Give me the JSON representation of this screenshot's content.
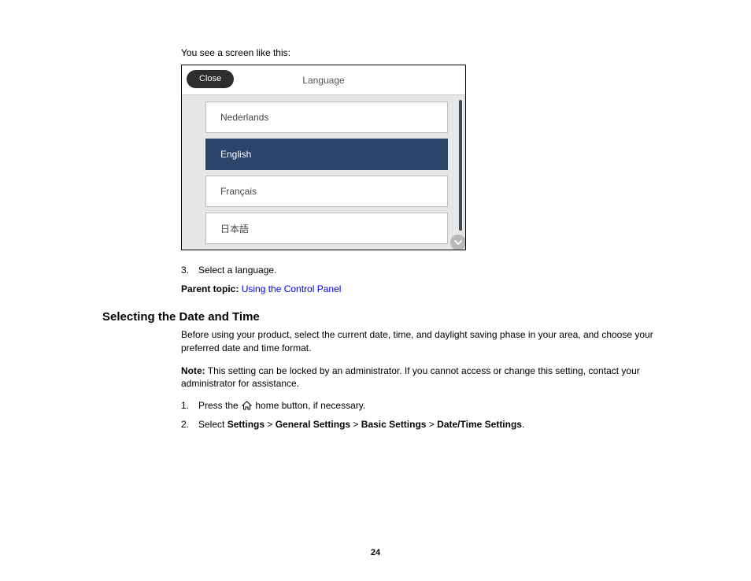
{
  "intro": "You see a screen like this:",
  "device": {
    "close_label": "Close",
    "title": "Language",
    "items": [
      "Nederlands",
      "English",
      "Français",
      "日本語"
    ],
    "selected_index": 1
  },
  "step3": {
    "num": "3.",
    "text": "Select a language."
  },
  "parent_topic": {
    "label": "Parent topic:",
    "link_text": "Using the Control Panel"
  },
  "section_heading": "Selecting the Date and Time",
  "section_intro": "Before using your product, select the current date, time, and daylight saving phase in your area, and choose your preferred date and time format.",
  "note_label": "Note:",
  "note_body": " This setting can be locked by an administrator. If you cannot access or change this setting, contact your administrator for assistance.",
  "steps": {
    "s1": {
      "num": "1.",
      "prefix": "Press the ",
      "suffix": " home button, if necessary."
    },
    "s2": {
      "num": "2.",
      "prefix": "Select ",
      "b1": "Settings",
      "gt": " > ",
      "b2": "General Settings",
      "b3": "Basic Settings",
      "b4": "Date/Time Settings",
      "period": "."
    }
  },
  "page_number": "24"
}
